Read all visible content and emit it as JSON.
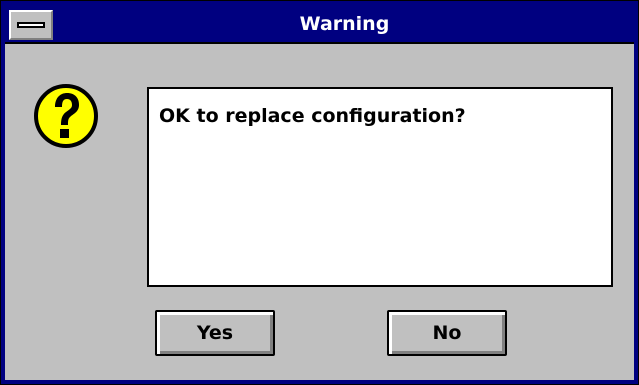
{
  "window": {
    "title": "Warning",
    "icon": "question-mark-icon"
  },
  "message": {
    "text": "OK to replace configuration?"
  },
  "buttons": {
    "yes_label": "Yes",
    "no_label": "No"
  },
  "colors": {
    "titlebar": "#000080",
    "face": "#c0c0c0",
    "icon_fill": "#ffff00"
  }
}
